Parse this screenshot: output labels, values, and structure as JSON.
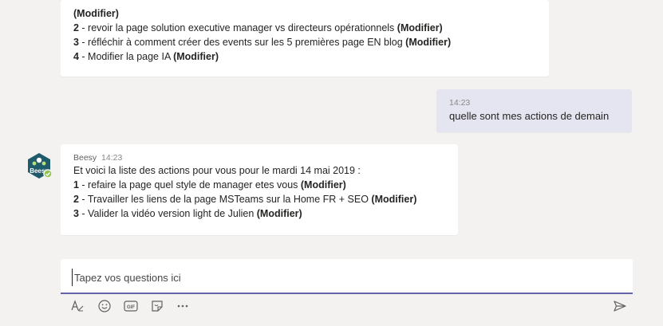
{
  "messages": {
    "top": {
      "line0_modif": "(Modifier)",
      "items": [
        {
          "num": "2",
          "text": " - revoir la page solution executive manager vs directeurs opérationnels ",
          "modif": "(Modifier)"
        },
        {
          "num": "3",
          "text": " - réfléchir à comment créer des events sur les 5 premières page EN blog ",
          "modif": "(Modifier)"
        },
        {
          "num": "4",
          "text": " - Modifier la page IA ",
          "modif": "(Modifier)"
        }
      ]
    },
    "user": {
      "time": "14:23",
      "text": "quelle sont mes actions de demain"
    },
    "bot": {
      "sender": "Beesy",
      "time": "14:23",
      "intro": "Et voici la liste des actions pour vous pour le mardi 14 mai 2019 :",
      "items": [
        {
          "num": "1",
          "text": " - refaire la page quel style de manager etes vous ",
          "modif": "(Modifier)"
        },
        {
          "num": "2",
          "text": " - Travailler les liens de la page MSTeams sur la Home FR + SEO ",
          "modif": "(Modifier)"
        },
        {
          "num": "3",
          "text": " - Valider la vidéo version light de Julien ",
          "modif": "(Modifier)"
        }
      ]
    }
  },
  "avatar": {
    "label": "Beesy",
    "accent": "#1f5b6b",
    "status_color": "#92c353"
  },
  "compose": {
    "placeholder": "Tapez vos questions ici"
  },
  "toolbar": {
    "icons": [
      "format-icon",
      "emoji-icon",
      "gif-icon",
      "sticker-icon",
      "more-icon",
      "send-icon"
    ],
    "gif_label": "GIF"
  },
  "colors": {
    "accent": "#6264a7",
    "user_bubble": "#e5e5f1",
    "background": "#f3f2f1"
  }
}
